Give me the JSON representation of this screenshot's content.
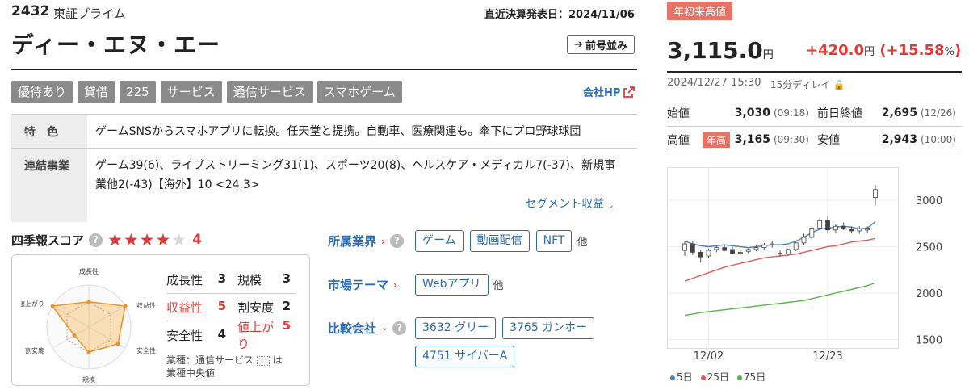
{
  "header": {
    "code": "2432",
    "market": "東証プライム",
    "report_date": "直近決算発表日：2024/11/06",
    "company_name": "ディー・エヌ・エー",
    "prev_button": "前号並み"
  },
  "tags": [
    "優待あり",
    "貸借",
    "225",
    "サービス",
    "通信サービス",
    "スマホゲーム"
  ],
  "company_hp": "会社HP",
  "features": {
    "feature_label": "特　色",
    "feature_text": "ゲームSNSからスマホアプリに転換。任天堂と提携。自動車、医療関連も。傘下にプロ野球球団",
    "segment_label": "連結事業",
    "segment_text": "ゲーム39(6)、ライブストリーミング31(1)、スポーツ20(8)、ヘルスケア・メディカル7(-37)、新規事業他2(-43)【海外】10 <24.3>",
    "segment_link": "セグメント収益"
  },
  "score": {
    "title": "四季報スコア",
    "stars": 4,
    "value": "4",
    "radar_labels": [
      "成長性",
      "収益性",
      "安全性",
      "規模",
      "割安度",
      "値上がり"
    ],
    "radar_values": [
      3,
      5,
      4,
      3,
      2,
      5
    ],
    "items": [
      {
        "name": "成長性",
        "value": "3",
        "red": false
      },
      {
        "name": "規模",
        "value": "3",
        "red": false
      },
      {
        "name": "収益性",
        "value": "5",
        "red": true
      },
      {
        "name": "割安度",
        "value": "2",
        "red": false
      },
      {
        "name": "安全性",
        "value": "4",
        "red": false
      },
      {
        "name": "値上がり",
        "value": "5",
        "red": true
      }
    ],
    "note_line1": "業種：通信サービス",
    "note_line1b": "は",
    "note_line2": "業種中央値"
  },
  "industry": {
    "label": "所属業界",
    "chips": [
      "ゲーム",
      "動画配信",
      "NFT"
    ],
    "other": "他"
  },
  "theme": {
    "label": "市場テーマ",
    "chips": [
      "Webアプリ"
    ],
    "other": "他"
  },
  "compare": {
    "label": "比較会社",
    "chips": [
      "3632 グリー",
      "3765 ガンホー",
      "4751 サイバーA"
    ]
  },
  "quote": {
    "badge": "年初来高値",
    "price": "3,115.0",
    "price_unit": "円",
    "change": "+420.0",
    "change_unit": "円",
    "change_pct": "+15.58",
    "pct_unit": "%",
    "time": "2024/12/27 15:30",
    "delay": "15分ディレイ",
    "rows": [
      {
        "l_label": "始値",
        "l_val": "3,030",
        "l_time": "(09:18)",
        "r_label": "前日終値",
        "r_val": "2,695",
        "r_time": "(12/26)"
      },
      {
        "l_label": "高値",
        "l_tag": "年高",
        "l_val": "3,165",
        "l_time": "(09:30)",
        "r_label": "安値",
        "r_val": "2,943",
        "r_time": "(10:00)"
      }
    ]
  },
  "chart_data": {
    "type": "candlestick",
    "x_ticks": [
      "12/02",
      "12/23"
    ],
    "y_ticks": [
      "3000",
      "2500",
      "2000",
      "1500"
    ],
    "ylim": [
      1400,
      3200
    ],
    "candles": [
      {
        "o": 2460,
        "h": 2560,
        "l": 2400,
        "c": 2530
      },
      {
        "o": 2530,
        "h": 2560,
        "l": 2410,
        "c": 2440
      },
      {
        "o": 2440,
        "h": 2470,
        "l": 2330,
        "c": 2390
      },
      {
        "o": 2400,
        "h": 2480,
        "l": 2380,
        "c": 2460
      },
      {
        "o": 2470,
        "h": 2510,
        "l": 2440,
        "c": 2490
      },
      {
        "o": 2490,
        "h": 2520,
        "l": 2450,
        "c": 2460
      },
      {
        "o": 2470,
        "h": 2500,
        "l": 2420,
        "c": 2430
      },
      {
        "o": 2430,
        "h": 2470,
        "l": 2410,
        "c": 2440
      },
      {
        "o": 2450,
        "h": 2480,
        "l": 2430,
        "c": 2470
      },
      {
        "o": 2470,
        "h": 2520,
        "l": 2450,
        "c": 2490
      },
      {
        "o": 2490,
        "h": 2540,
        "l": 2470,
        "c": 2520
      },
      {
        "o": 2520,
        "h": 2560,
        "l": 2490,
        "c": 2530
      },
      {
        "o": 2430,
        "h": 2460,
        "l": 2390,
        "c": 2420
      },
      {
        "o": 2420,
        "h": 2480,
        "l": 2400,
        "c": 2470
      },
      {
        "o": 2470,
        "h": 2560,
        "l": 2450,
        "c": 2540
      },
      {
        "o": 2540,
        "h": 2640,
        "l": 2520,
        "c": 2600
      },
      {
        "o": 2600,
        "h": 2720,
        "l": 2580,
        "c": 2700
      },
      {
        "o": 2700,
        "h": 2810,
        "l": 2680,
        "c": 2780
      },
      {
        "o": 2780,
        "h": 2830,
        "l": 2640,
        "c": 2680
      },
      {
        "o": 2680,
        "h": 2740,
        "l": 2650,
        "c": 2720
      },
      {
        "o": 2720,
        "h": 2760,
        "l": 2680,
        "c": 2700
      },
      {
        "o": 2690,
        "h": 2720,
        "l": 2650,
        "c": 2670
      },
      {
        "o": 2670,
        "h": 2720,
        "l": 2640,
        "c": 2690
      },
      {
        "o": 2680,
        "h": 2720,
        "l": 2650,
        "c": 2700
      },
      {
        "o": 3030,
        "h": 3165,
        "l": 2943,
        "c": 3115
      }
    ],
    "series": [
      {
        "name": "5日",
        "color": "#4a7fc1",
        "values": [
          2560,
          2530,
          2510,
          2500,
          2510,
          2520,
          2510,
          2500,
          2490,
          2500,
          2510,
          2520,
          2520,
          2530,
          2560,
          2600,
          2650,
          2690,
          2700,
          2710,
          2720,
          2710,
          2690,
          2700,
          2770
        ]
      },
      {
        "name": "25日",
        "color": "#e05c5c",
        "values": [
          2130,
          2160,
          2190,
          2220,
          2250,
          2280,
          2300,
          2320,
          2340,
          2360,
          2380,
          2390,
          2400,
          2410,
          2420,
          2440,
          2460,
          2480,
          2500,
          2510,
          2530,
          2550,
          2560,
          2570,
          2590
        ]
      },
      {
        "name": "75日",
        "color": "#5ab34a",
        "values": [
          1760,
          1775,
          1790,
          1800,
          1810,
          1820,
          1830,
          1840,
          1850,
          1860,
          1870,
          1880,
          1890,
          1900,
          1910,
          1920,
          1940,
          1960,
          1980,
          2000,
          2020,
          2040,
          2060,
          2080,
          2110
        ]
      }
    ]
  }
}
